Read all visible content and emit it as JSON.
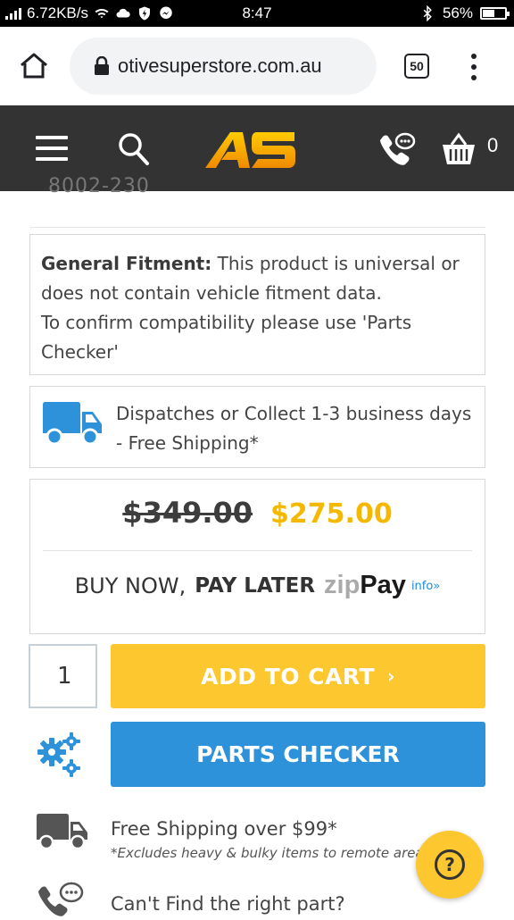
{
  "status_bar": {
    "net_speed": "6.72KB/s",
    "time": "8:47",
    "battery_pct": "56%",
    "battery_level": 0.56
  },
  "browser": {
    "url": "otivesuperstore.com.au",
    "tab_count": "50"
  },
  "site_header": {
    "logo_text": "AS",
    "cart_count": "0",
    "brand_color": "#f5a300"
  },
  "product": {
    "partial_code": "8002-230",
    "fitment_label": "General Fitment:",
    "fitment_text": "This product is universal or does not contain vehicle fitment data.",
    "fitment_confirm": "To confirm compatibility please use 'Parts Checker'",
    "dispatch_line1": "Dispatches or Collect 1-3 business days",
    "dispatch_line2": "- Free Shipping*",
    "old_price": "$349.00",
    "new_price": "$275.00",
    "buy_now": "BUY NOW,",
    "pay_later": "PAY LATER",
    "zip_part1": "zip",
    "zip_part2": "Pay",
    "zip_info": "info»",
    "quantity": "1",
    "add_to_cart": "ADD TO CART",
    "add_chevron": "›",
    "parts_checker": "PARTS CHECKER"
  },
  "features": {
    "shipping_title": "Free Shipping over $99*",
    "shipping_note": "*Excludes heavy & bulky items to remote areas",
    "find_part": "Can't Find the right part?"
  },
  "help": {
    "symbol": "?"
  }
}
